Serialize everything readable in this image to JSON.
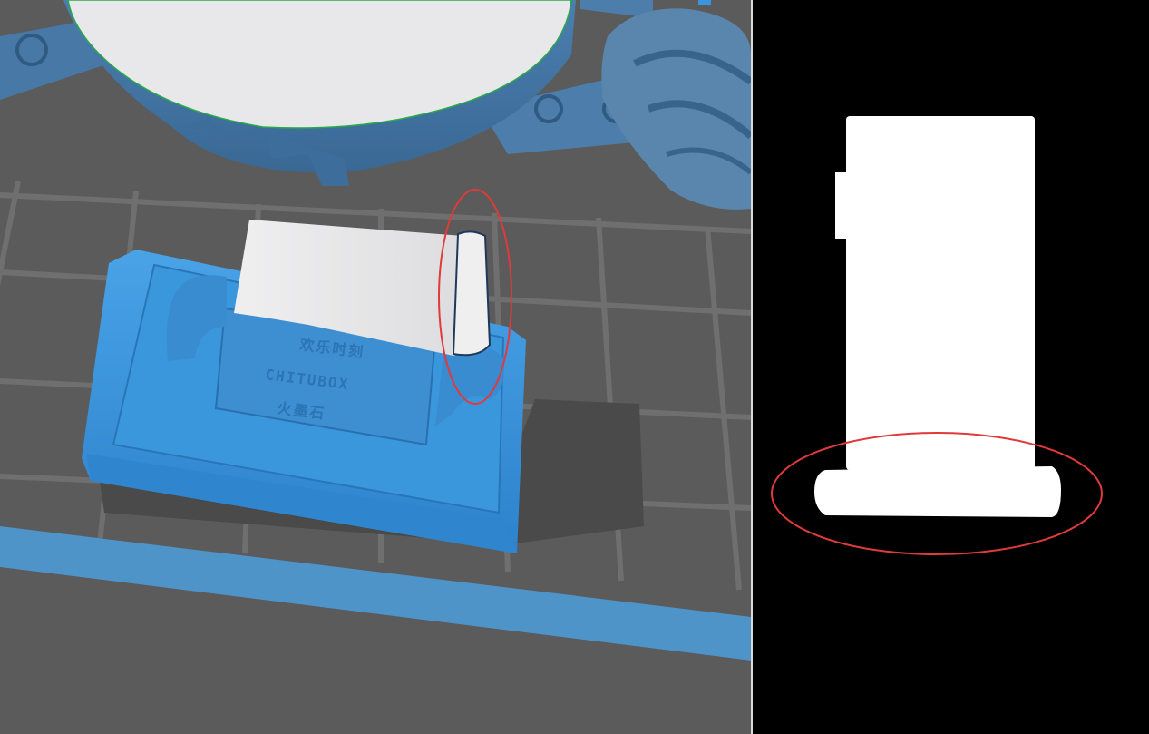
{
  "viewport": {
    "model_text": {
      "line1": "欢乐时刻",
      "line2": "CHITUBOX",
      "line3": "火墨石"
    }
  },
  "colors": {
    "model": "#3b93d8",
    "model_dark": "#2a6fae",
    "build_plate": "#5b5b5b",
    "grid_line": "#6e6e6e",
    "support_white": "#e9e9ea",
    "highlight": "#e03a3a",
    "slice_bg": "#000000",
    "slice_fill": "#ffffff"
  },
  "icons": {
    "model": "3d-model-icon",
    "highlight": "highlight-ellipse"
  }
}
